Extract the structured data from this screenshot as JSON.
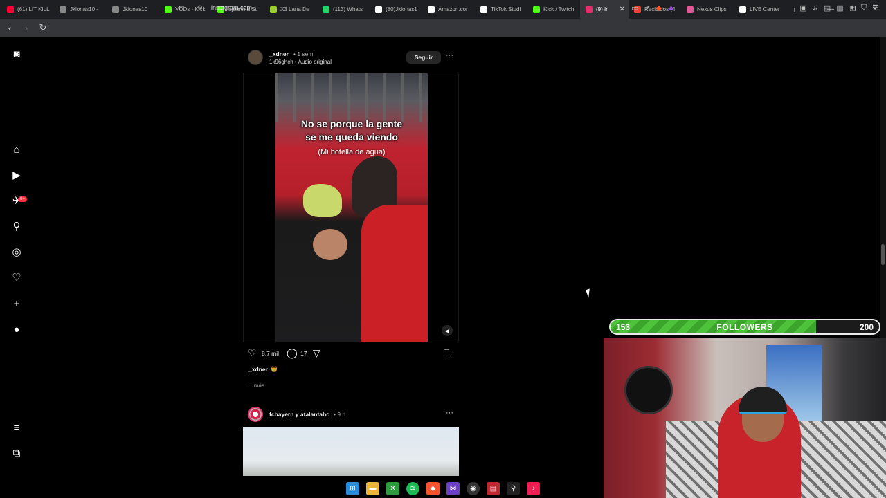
{
  "browser": {
    "tabs": [
      {
        "title": "(61) LIT KILL",
        "color": "#ff0033"
      },
      {
        "title": "Jklonas10 -",
        "color": "#888888"
      },
      {
        "title": "Jklonas10",
        "color": "#888888"
      },
      {
        "title": "VODs - Kick",
        "color": "#53fc18"
      },
      {
        "title": "isjuanma St",
        "color": "#53fc18"
      },
      {
        "title": "X3 Lana De",
        "color": "#9acd32"
      },
      {
        "title": "(113) Whats",
        "color": "#25d366"
      },
      {
        "title": "(80)Jklonas1",
        "color": "#ffffff"
      },
      {
        "title": "Amazon.cor",
        "color": "#ffffff"
      },
      {
        "title": "TikTok Studi",
        "color": "#ffffff"
      },
      {
        "title": "Kick / Twitch",
        "color": "#53fc18"
      },
      {
        "title": "(9) Ir",
        "color": "#e1306c",
        "active": true
      },
      {
        "title": "Recibidos (4",
        "color": "#ea4335"
      },
      {
        "title": "Nexus Clips",
        "color": "#e05a9a"
      },
      {
        "title": "LIVE Center",
        "color": "#ffffff"
      }
    ],
    "new_tab": "+",
    "url": "instagram.com"
  },
  "post1": {
    "username": "_xdner",
    "time": "• 1 sem",
    "audio": "1k96ghch • Audio original",
    "follow_label": "Seguir",
    "more": "···",
    "video_caption_line1": "No se porque la gente",
    "video_caption_line2": "se me queda viendo",
    "video_caption_sub": "(Mi botella de agua)",
    "likes": "8,7 mil",
    "comments": "17",
    "caption_user": "_xdner",
    "caption_emoji": "👑",
    "more_link": "... más"
  },
  "post2": {
    "username": "fcbayern y atalantabc",
    "time": "• 9 h",
    "more": "···"
  },
  "sidebar": {
    "notif_badge": "9+"
  },
  "overlay": {
    "followers_current": "153",
    "followers_label": "FOLLOWERS",
    "followers_goal": "200",
    "progress": 0.765
  },
  "colors": {
    "accent_red": "#ff3040",
    "followers_green": "#4fc23c"
  }
}
